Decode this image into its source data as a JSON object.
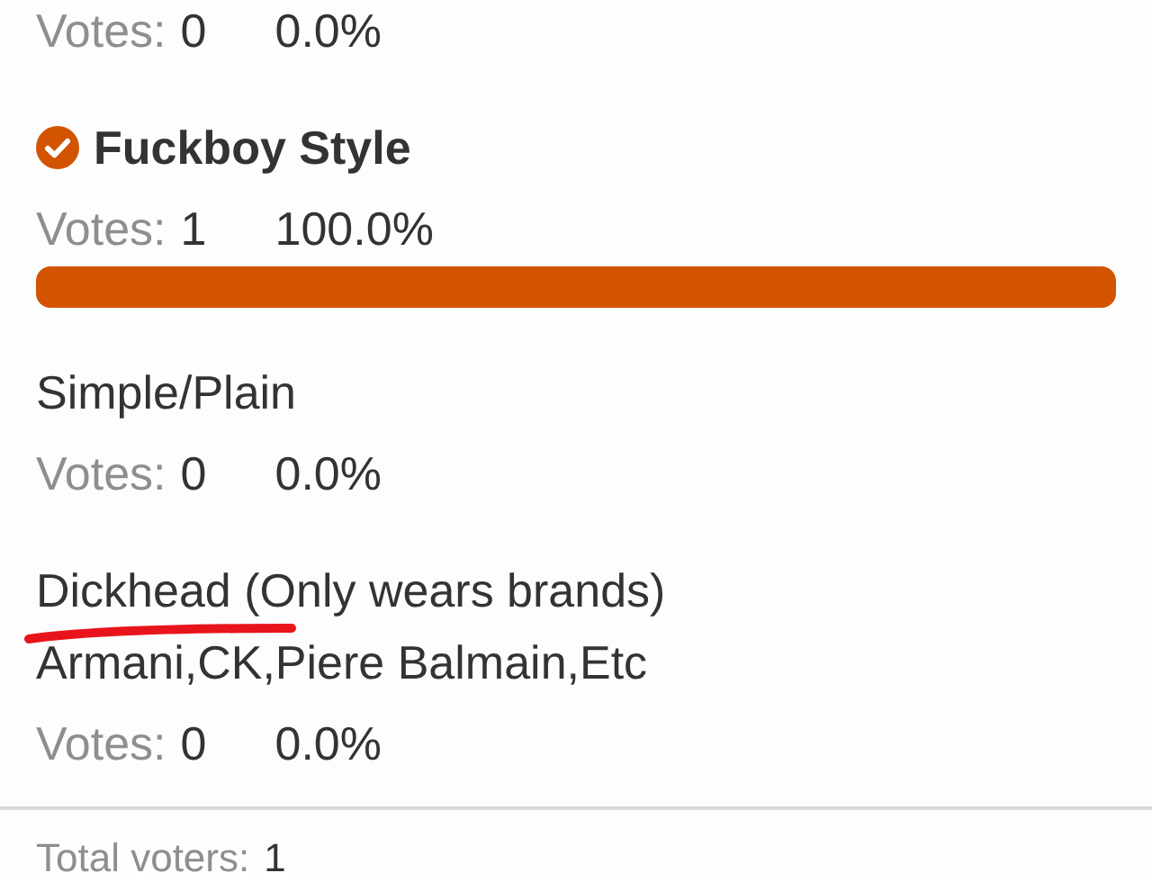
{
  "options": [
    {
      "votes_label": "Votes:",
      "votes": "0",
      "percent": "0.0%",
      "bar": false,
      "selected": false
    },
    {
      "label_lines": [
        "Fuckboy Style"
      ],
      "votes_label": "Votes:",
      "votes": "1",
      "percent": "100.0%",
      "bar": true,
      "selected": true
    },
    {
      "label_lines": [
        "Simple/Plain"
      ],
      "votes_label": "Votes:",
      "votes": "0",
      "percent": "0.0%",
      "bar": false,
      "selected": false
    },
    {
      "label_lines": [
        "Dickhead (Only wears brands)",
        "Armani,CK,Piere Balmain,Etc"
      ],
      "votes_label": "Votes:",
      "votes": "0",
      "percent": "0.0%",
      "bar": false,
      "selected": false
    }
  ],
  "total": {
    "label": "Total voters:",
    "value": "1"
  }
}
